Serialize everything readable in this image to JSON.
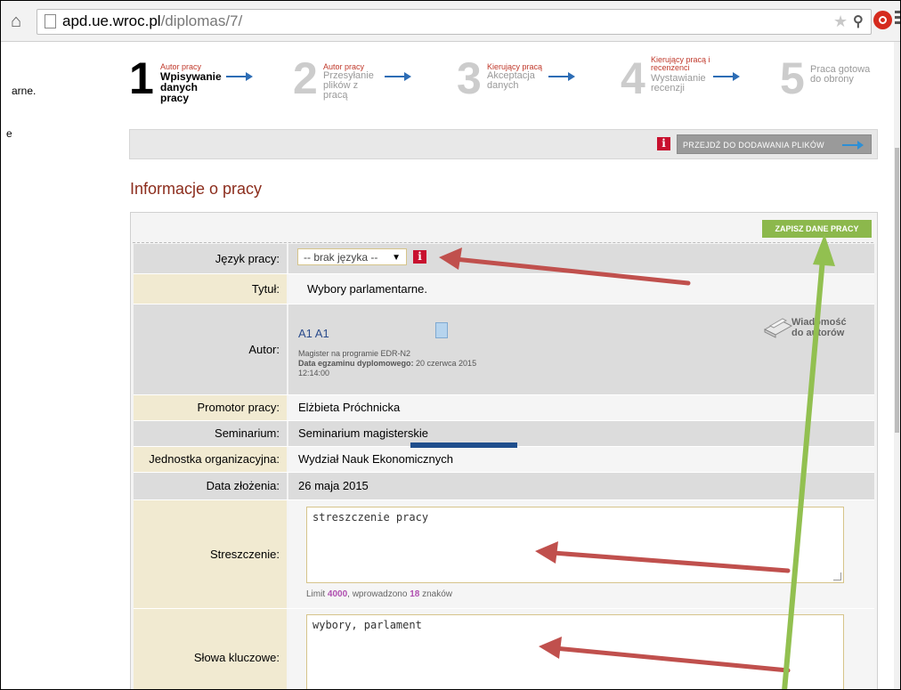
{
  "browser": {
    "url_host": "apd.ue.wroc.pl",
    "url_path": "/diplomas/7/"
  },
  "sidebar": {
    "fragments": [
      "arne.",
      "e"
    ]
  },
  "steps": [
    {
      "number": "1",
      "who": "Autor pracy",
      "what": "Wpisywanie danych pracy",
      "active": true
    },
    {
      "number": "2",
      "who": "Autor pracy",
      "what": "Przesyłanie plików z pracą",
      "active": false
    },
    {
      "number": "3",
      "who": "Kierujący pracą",
      "what": "Akceptacja danych",
      "active": false
    },
    {
      "number": "4",
      "who": "Kierujący pracą i recenzenci",
      "what": "Wystawianie recenzji",
      "active": false
    },
    {
      "number": "5",
      "who": "",
      "what": "Praca gotowa do obrony",
      "active": false
    }
  ],
  "actionbar": {
    "info_glyph": "i",
    "goto_label": "PRZEJDŹ DO DODAWANIA PLIKÓW"
  },
  "section_title": "Informacje o pracy",
  "form": {
    "save_label": "ZAPISZ DANE PRACY",
    "language": {
      "label": "Język pracy:",
      "value": "-- brak języka --",
      "info_glyph": "i"
    },
    "title": {
      "label": "Tytuł:",
      "value": "Wybory parlamentarne."
    },
    "author": {
      "label": "Autor:",
      "name": "A1 A1",
      "program": "Magister na programie EDR-N2",
      "exam_label": "Data egzaminu dyplomowego:",
      "exam_date": "20 czerwca 2015",
      "exam_time": "12:14:00",
      "message_label_1": "Wiadomość",
      "message_label_2": "do autorów"
    },
    "supervisor": {
      "label": "Promotor pracy:",
      "value": "Elżbieta Próchnicka"
    },
    "seminar": {
      "label": "Seminarium:",
      "value": "Seminarium magisterskie"
    },
    "unit": {
      "label": "Jednostka organizacyjna:",
      "value": "Wydział Nauk Ekonomicznych"
    },
    "submitted": {
      "label": "Data złożenia:",
      "value": "26 maja 2015"
    },
    "abstract": {
      "label": "Streszczenie:",
      "value": "streszczenie pracy",
      "limit_prefix": "Limit",
      "limit_max": "4000",
      "limit_mid": ", wprowadzono",
      "limit_count": "18",
      "limit_suffix": "znaków"
    },
    "keywords": {
      "label": "Słowa kluczowe:",
      "value": "wybory, parlament"
    }
  },
  "colors": {
    "annotation_red": "#c0504d",
    "annotation_green": "#92c050",
    "redaction_blue": "#1f4e8c"
  }
}
